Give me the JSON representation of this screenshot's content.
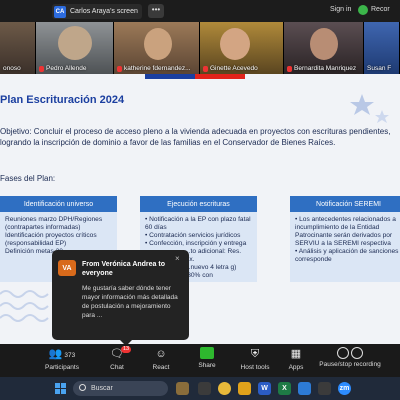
{
  "topbar": {
    "share_badge": "CA",
    "share_text": "Carlos Araya's screen",
    "more": "•••",
    "signin": "Sign in",
    "rec": "Recor"
  },
  "participants_strip": [
    {
      "name": "onoso",
      "color": "#5a4a3c"
    },
    {
      "name": "Pedro Allende",
      "color": "#6b6f72"
    },
    {
      "name": "katherine fdernandez...",
      "color": "#7a5c3e"
    },
    {
      "name": "Ginette Acevedo",
      "color": "#8a6a2e"
    },
    {
      "name": "Bernardita Manriquez",
      "color": "#4b4245"
    },
    {
      "name": "Susan F",
      "color": "#2f4f8a"
    }
  ],
  "slide": {
    "title": "Plan Escrituración 2024",
    "objective": "Objetivo: Concluir el proceso de acceso pleno a la vivienda adecuada en proyectos con escrituras pendientes, logrando la inscripción de dominio a favor de las familias en el Conservador de Bienes Raíces.",
    "phases_label": "Fases del Plan:",
    "columns": [
      {
        "header": "Identificación universo",
        "items": [
          "Reuniones marzo DPH/Regiones",
          "(contrapartes informadas)",
          "Identificación proyectos críticos",
          "(responsabilidad EP)",
          "Definición metas 20"
        ]
      },
      {
        "header": "Ejecución escrituras",
        "items": [
          "• Notificación a la EP con plazo fatal 60 días",
          "• Contratación servicios jurídicos",
          "• Confección, inscripción y entrega",
          "",
          "...to adicional: Res. Ex.",
          "...nuevo 4 letra g) (30% con"
        ]
      },
      {
        "header": "Notificación SEREMI",
        "items": [
          "• Los antecedentes relacionados a incumplimiento de la Entidad Patrocinante serán derivados por SERVIU a la SEREMI respectiva",
          "• Análisis y aplicación de sanciones corresponde"
        ]
      }
    ]
  },
  "chat_toast": {
    "avatar": "VA",
    "from": "From Verónica Andrea to everyone",
    "close": "×",
    "message": "Me gustaría saber dónde tener mayor información más detallada de postulación a mejoramiento para ..."
  },
  "toolbar": {
    "participants_label": "Participants",
    "participants_count": "373",
    "chat_label": "Chat",
    "chat_badge": "13",
    "react_label": "React",
    "share_label": "Share",
    "host_tools_label": "Host tools",
    "apps_label": "Apps",
    "pause_label": "Pause/stop recording"
  },
  "taskbar": {
    "search_placeholder": "Buscar"
  }
}
